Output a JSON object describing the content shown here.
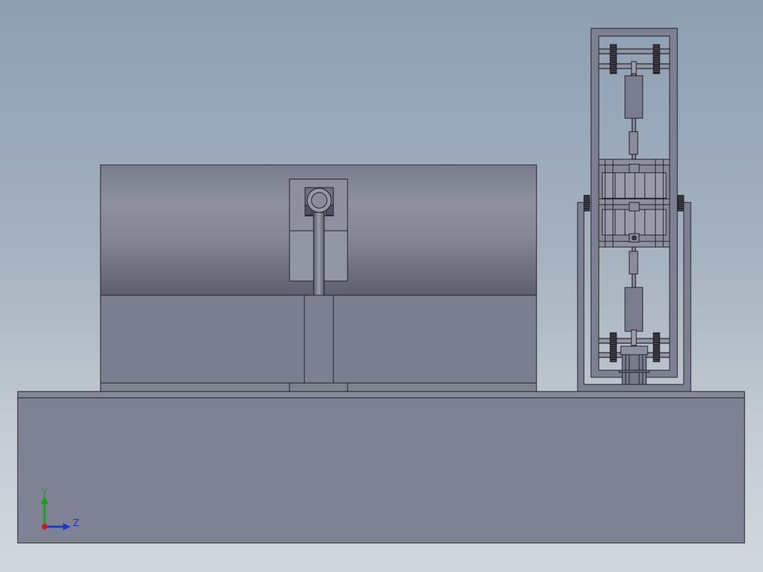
{
  "viewport": {
    "background_top": "#8d9fb2",
    "background_bottom": "#d3d8de"
  },
  "triad": {
    "y_label": "Y",
    "z_label": "Z",
    "y_color": "#1aa01a",
    "z_color": "#1a3acc",
    "x_color": "#cc1a1a"
  },
  "model": {
    "edge_color": "#1e1e26",
    "base_color": "#7e8294",
    "part_color": "#7c7f90"
  }
}
